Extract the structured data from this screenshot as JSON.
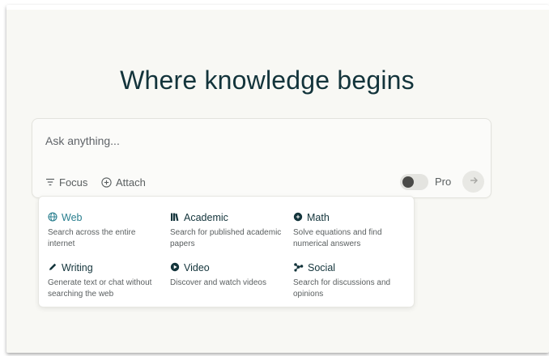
{
  "hero": {
    "headline": "Where knowledge begins"
  },
  "search": {
    "placeholder": "Ask anything...",
    "focus_label": "Focus",
    "attach_label": "Attach",
    "pro_label": "Pro",
    "pro_enabled": false
  },
  "focus_menu": {
    "selected": "Web",
    "items": [
      {
        "label": "Web",
        "icon": "globe-icon",
        "description": "Search across the entire internet"
      },
      {
        "label": "Academic",
        "icon": "books-icon",
        "description": "Search for published academic papers"
      },
      {
        "label": "Math",
        "icon": "math-icon",
        "description": "Solve equations and find numerical answers"
      },
      {
        "label": "Writing",
        "icon": "pen-icon",
        "description": "Generate text or chat without searching the web"
      },
      {
        "label": "Video",
        "icon": "play-icon",
        "description": "Discover and watch videos"
      },
      {
        "label": "Social",
        "icon": "social-network-icon",
        "description": "Search for discussions and opinions"
      }
    ]
  },
  "colors": {
    "background": "#f8f8f4",
    "headline": "#13343b",
    "accent": "#2a7f8f"
  }
}
